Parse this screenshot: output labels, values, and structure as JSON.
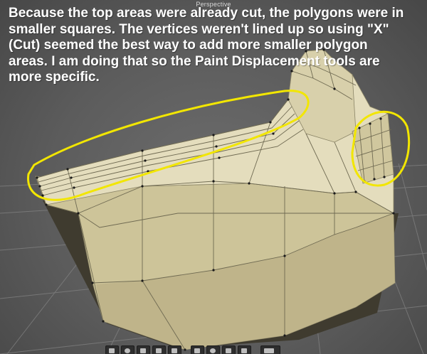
{
  "viewport": {
    "label": "Perspective"
  },
  "annotation": {
    "text": "Because the top areas were already cut, the polygons were in smaller squares. The vertices weren't lined up so using \"X\" (Cut) seemed the best way to add more smaller polygon areas. I am doing that  so the Paint Displacement tools are more specific."
  },
  "colors": {
    "background": "#5a5a5a",
    "grid": "#8a8a8a",
    "mesh_light": "#e6dfc0",
    "mesh_front": "#cfc59a",
    "mesh_dark": "#3f3b2f",
    "highlight_loop": "#f2e600",
    "annotation_text": "#ffffff"
  },
  "toolbar": {
    "icons": [
      "cube-icon",
      "sphere-icon",
      "cone-icon",
      "camera-icon",
      "light-icon",
      "move-icon",
      "rotate-icon",
      "scale-icon",
      "select-icon",
      "more-icon"
    ]
  }
}
